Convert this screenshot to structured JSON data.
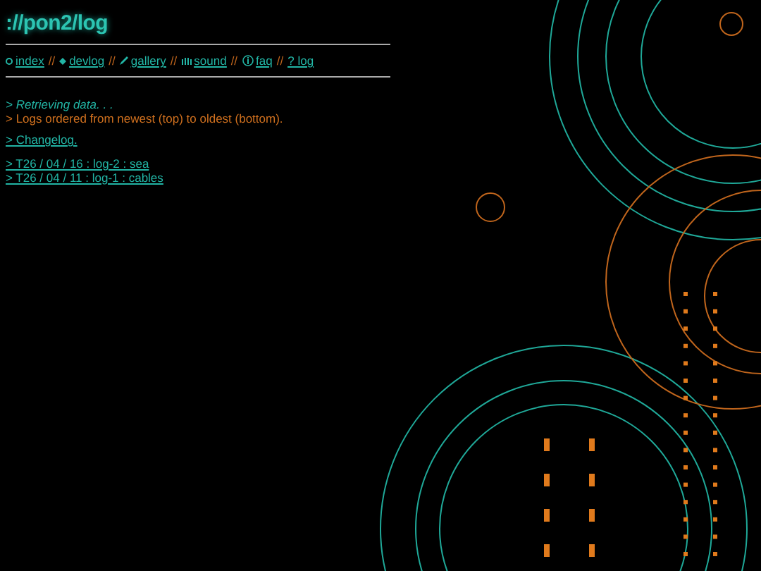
{
  "site_title": "://pon2/log",
  "nav": [
    {
      "label": "index"
    },
    {
      "label": "devlog"
    },
    {
      "label": "gallery"
    },
    {
      "label": "sound"
    },
    {
      "label": "faq"
    },
    {
      "label": "? log"
    }
  ],
  "separator": "//",
  "messages": [
    {
      "kind": "status",
      "text": "> Retrieving data. . ."
    },
    {
      "kind": "note",
      "text": "> Logs ordered from newest (top) to oldest (bottom)."
    }
  ],
  "changelog_link": "> Changelog.",
  "entries": [
    "> T26 / 04 / 16 : log-2 : sea",
    "> T26 / 04 / 11 : log-1 : cables"
  ]
}
